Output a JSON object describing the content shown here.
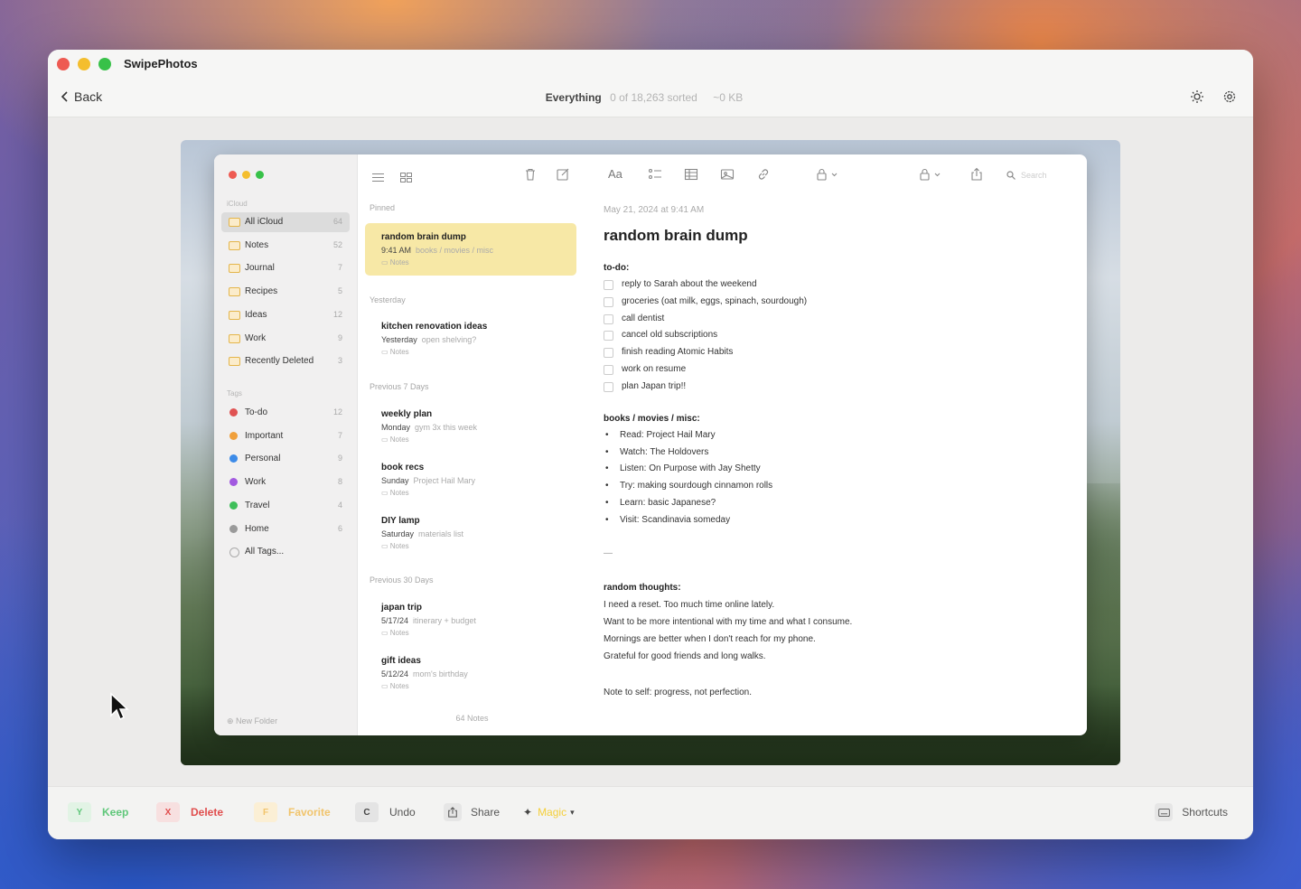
{
  "app": {
    "title": "SwipePhotos"
  },
  "nav": {
    "back_label": "Back",
    "filter": "Everything",
    "progress": "0 of 18,263 sorted",
    "size": "~0 KB",
    "icons": [
      "sun-icon",
      "gear-icon"
    ]
  },
  "notes_app": {
    "sidebar": {
      "section_icloud": "iCloud",
      "folders": [
        {
          "label": "All iCloud",
          "count": "64",
          "active": true
        },
        {
          "label": "Notes",
          "count": "52"
        },
        {
          "label": "Journal",
          "count": "7"
        },
        {
          "label": "Recipes",
          "count": "5"
        },
        {
          "label": "Ideas",
          "count": "12"
        },
        {
          "label": "Work",
          "count": "9"
        },
        {
          "label": "Recently Deleted",
          "count": "3"
        }
      ],
      "section_tags": "Tags",
      "tags": [
        {
          "label": "To-do",
          "count": "12",
          "color": "#e05252"
        },
        {
          "label": "Important",
          "count": "7",
          "color": "#f0a03c"
        },
        {
          "label": "Personal",
          "count": "9",
          "color": "#3d8be8"
        },
        {
          "label": "Work",
          "count": "8",
          "color": "#a259e0"
        },
        {
          "label": "Travel",
          "count": "4",
          "color": "#3fbf5a"
        },
        {
          "label": "Home",
          "count": "6",
          "color": "#9a9a9a"
        },
        {
          "label": "All Tags...",
          "count": ""
        }
      ],
      "new_folder": "New Folder"
    },
    "list": {
      "groups": {
        "pinned": "Pinned",
        "yesterday": "Yesterday",
        "prev7": "Previous 7 Days",
        "prev30": "Previous 30 Days"
      },
      "notes": [
        {
          "title": "random brain dump",
          "time": "9:41 AM",
          "preview": "books / movies / misc",
          "folder": "Notes"
        },
        {
          "title": "kitchen renovation ideas",
          "time": "Yesterday",
          "preview": "open shelving?",
          "folder": "Notes"
        },
        {
          "title": "weekly plan",
          "time": "Monday",
          "preview": "gym 3x this week",
          "folder": "Notes"
        },
        {
          "title": "book recs",
          "time": "Sunday",
          "preview": "Project Hail Mary",
          "folder": "Notes"
        },
        {
          "title": "DIY lamp",
          "time": "Saturday",
          "preview": "materials list",
          "folder": "Notes"
        },
        {
          "title": "japan trip",
          "time": "5/17/24",
          "preview": "itinerary + budget",
          "folder": "Notes"
        },
        {
          "title": "gift ideas",
          "time": "5/12/24",
          "preview": "mom's birthday",
          "folder": "Notes"
        }
      ],
      "footer": "64 Notes"
    },
    "toolbar": {
      "search_placeholder": "Search"
    },
    "editor": {
      "date": "May 21, 2024 at 9:41 AM",
      "title": "random brain dump",
      "todo_heading": "to-do:",
      "todos": [
        "reply to Sarah about the weekend",
        "groceries (oat milk, eggs, spinach, sourdough)",
        "call dentist",
        "cancel old subscriptions",
        "finish reading Atomic Habits",
        "work on resume",
        "plan Japan trip!!"
      ],
      "misc_heading": "books / movies / misc:",
      "misc": [
        "Read: Project Hail Mary",
        "Watch: The Holdovers",
        "Listen: On Purpose with Jay Shetty",
        "Try: making sourdough cinnamon rolls",
        "Learn: basic Japanese?",
        "Visit: Scandinavia someday"
      ],
      "divider": "—",
      "thoughts_heading": "random thoughts:",
      "thoughts": [
        "I need a reset. Too much time online lately.",
        "Want to be more intentional with my time and what I consume.",
        "Mornings are better when I don't reach for my phone.",
        "Grateful for good friends and long walks."
      ],
      "closing": "Note to self: progress, not perfection."
    }
  },
  "actions": {
    "keep": {
      "key": "Y",
      "label": "Keep",
      "color": "#5fc77a"
    },
    "delete": {
      "key": "X",
      "label": "Delete",
      "color": "#e04d4d"
    },
    "favorite": {
      "key": "F",
      "label": "Favorite",
      "color": "#f1c46c"
    },
    "undo": {
      "key": "C",
      "label": "Undo"
    },
    "share": {
      "label": "Share"
    },
    "magic": {
      "label": "Magic",
      "color": "#f4cf3a"
    },
    "shortcuts": {
      "label": "Shortcuts"
    }
  }
}
